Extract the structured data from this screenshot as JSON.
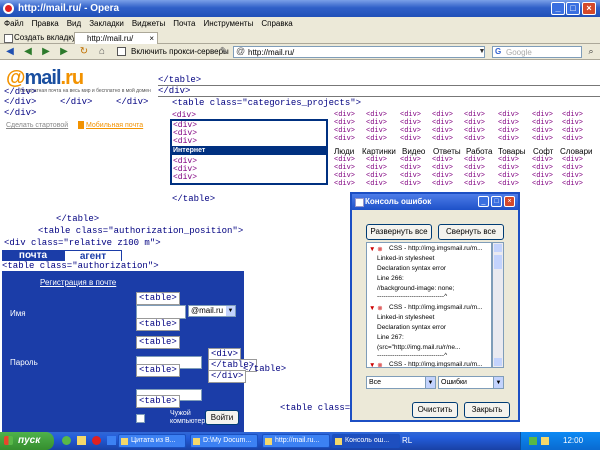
{
  "window": {
    "title": "http://mail.ru/ - Opera"
  },
  "menu": [
    "Файл",
    "Правка",
    "Вид",
    "Закладки",
    "Виджеты",
    "Почта",
    "Инструменты",
    "Справка"
  ],
  "tabs": {
    "new_tab": "Создать вкладку",
    "active_tab": "http://mail.ru/"
  },
  "toolbar": {
    "proxy_label": "Включить прокси-серверы",
    "address": "http://mail.ru/",
    "search_placeholder": "Google"
  },
  "page": {
    "logo_at": "@",
    "logo_mail": "mail",
    "logo_ru": ".ru",
    "tagline": "бесплатная почта на весь мир и бесплатно в мой домен",
    "links": {
      "start_page": "Сделать стартовой",
      "mobile_mail": "Мобильная почта"
    },
    "markup": {
      "t_close": "</table>",
      "div_close": "</div>",
      "div_open": "<div>",
      "table_cat": "<table class=\"categories_projects\">",
      "table_auth_pos": "<table class=\"authorization_position\">",
      "div_relative": "<div class=\"relative z100 m\">",
      "table_auth": "<table class=\"authorization\">",
      "table_open": "<table>",
      "table_text": "<table class=\"text_ac"
    },
    "categories": [
      "Люди",
      "Картинки",
      "Видео",
      "Ответы",
      "Работа",
      "Товары",
      "Софт",
      "Словари"
    ],
    "cat_selected": "Интернет",
    "auth": {
      "tab_mail": "почта",
      "tab_agent": "агент",
      "register": "Регистрация в почте",
      "name_label": "Имя",
      "password_label": "Пароль",
      "domain": "@mail.ru",
      "alien": "Чужой компьютер",
      "login_button": "Войти"
    }
  },
  "console": {
    "title": "Консоль ошибок",
    "expand_all": "Развернуть все",
    "collapse_all": "Свернуть все",
    "lines": [
      "CSS - http://img.imgsmail.ru/m...",
      "Linked-in stylesheet",
      "Declaration syntax error",
      "Line 266:",
      "  //background-image: none;",
      "  -------------------------------^",
      "CSS - http://img.imgsmail.ru/m...",
      "Linked-in stylesheet",
      "Declaration syntax error",
      "Line 267:",
      "  (src=\"http://img.mail.ru/r/ne...",
      "  -------------------------------^",
      "CSS - http://img.imgsmail.ru/m..."
    ],
    "filter_all": "Все",
    "filter_errors": "Ошибки",
    "clear_button": "Очистить",
    "close_button": "Закрыть"
  },
  "taskbar": {
    "start": "пуск",
    "items": [
      "Цитата из В...",
      "D:\\My Docum...",
      "http://mail.ru...",
      "Консоль ош..."
    ],
    "lang": "RL",
    "time": "12:00"
  }
}
